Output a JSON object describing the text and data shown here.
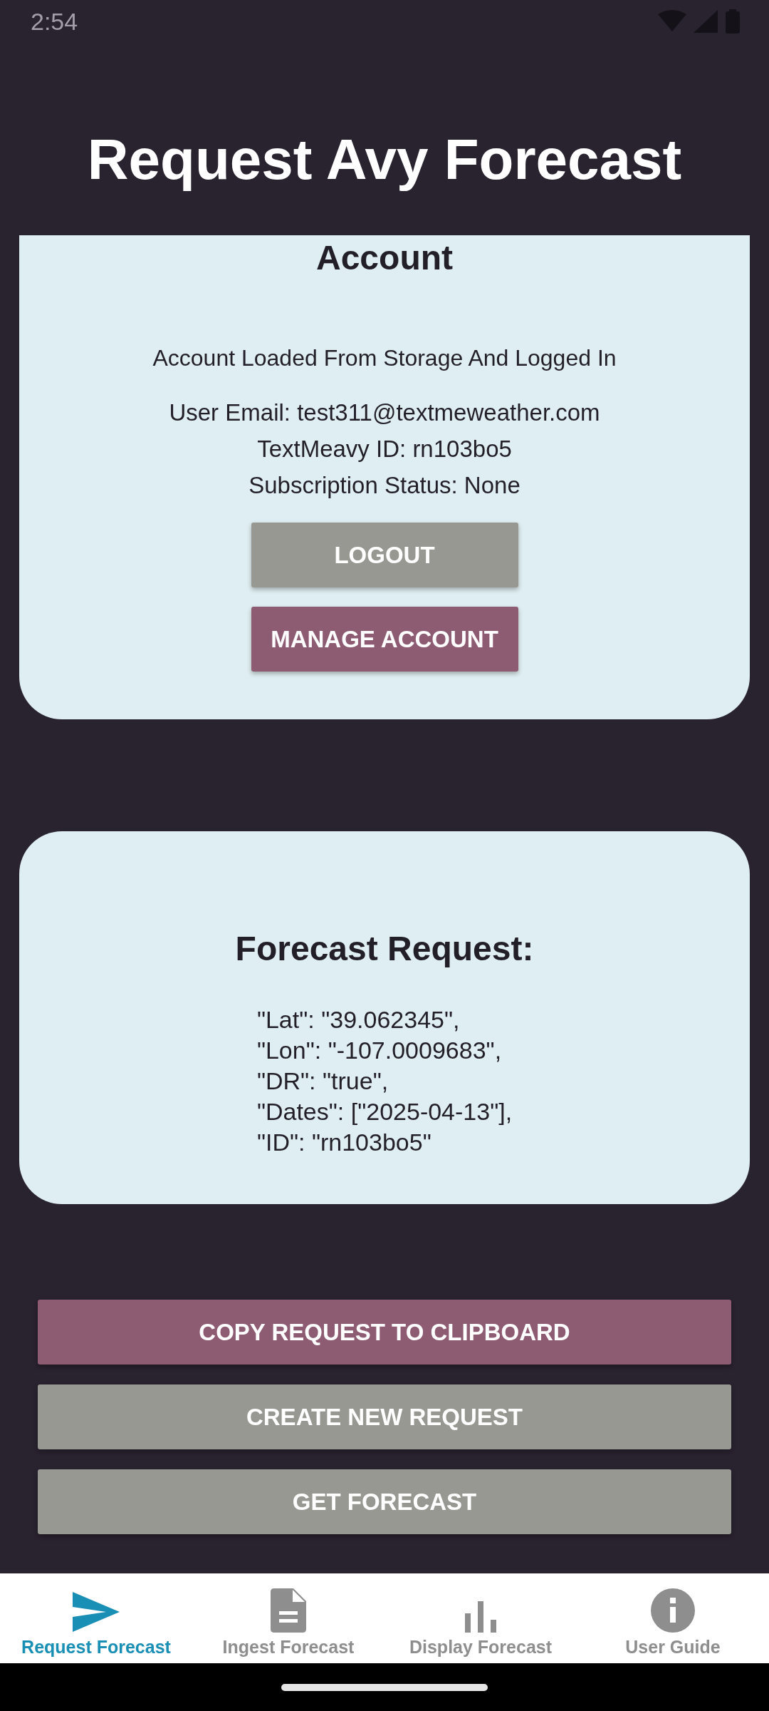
{
  "status_bar": {
    "time": "2:54"
  },
  "title": "Request Avy Forecast",
  "account": {
    "heading": "Account",
    "status": "Account Loaded From Storage And Logged In",
    "details": [
      "User Email: test311@textmeweather.com",
      "TextMeavy ID: rn103bo5",
      "Subscription Status: None"
    ],
    "buttons": [
      {
        "label": "LOGOUT",
        "kind": "secondary"
      },
      {
        "label": "MANAGE ACCOUNT",
        "kind": "primary"
      }
    ]
  },
  "forecast": {
    "heading": "Forecast Request:",
    "lines": [
      "\"Lat\": \"39.062345\",",
      "\"Lon\": \"-107.0009683\",",
      "\"DR\": \"true\",",
      "\"Dates\": [\"2025-04-13\"],",
      "\"ID\": \"rn103bo5\""
    ]
  },
  "actions": [
    {
      "label": "COPY REQUEST TO CLIPBOARD",
      "kind": "primary"
    },
    {
      "label": "CREATE NEW REQUEST",
      "kind": "secondary"
    },
    {
      "label": "GET FORECAST",
      "kind": "secondary"
    }
  ],
  "nav": [
    {
      "label": "Request Forecast",
      "kind": "send",
      "selected": true
    },
    {
      "label": "Ingest Forecast",
      "kind": "document",
      "selected": false
    },
    {
      "label": "Display Forecast",
      "kind": "chart",
      "selected": false
    },
    {
      "label": "User Guide",
      "kind": "info",
      "selected": false
    }
  ]
}
